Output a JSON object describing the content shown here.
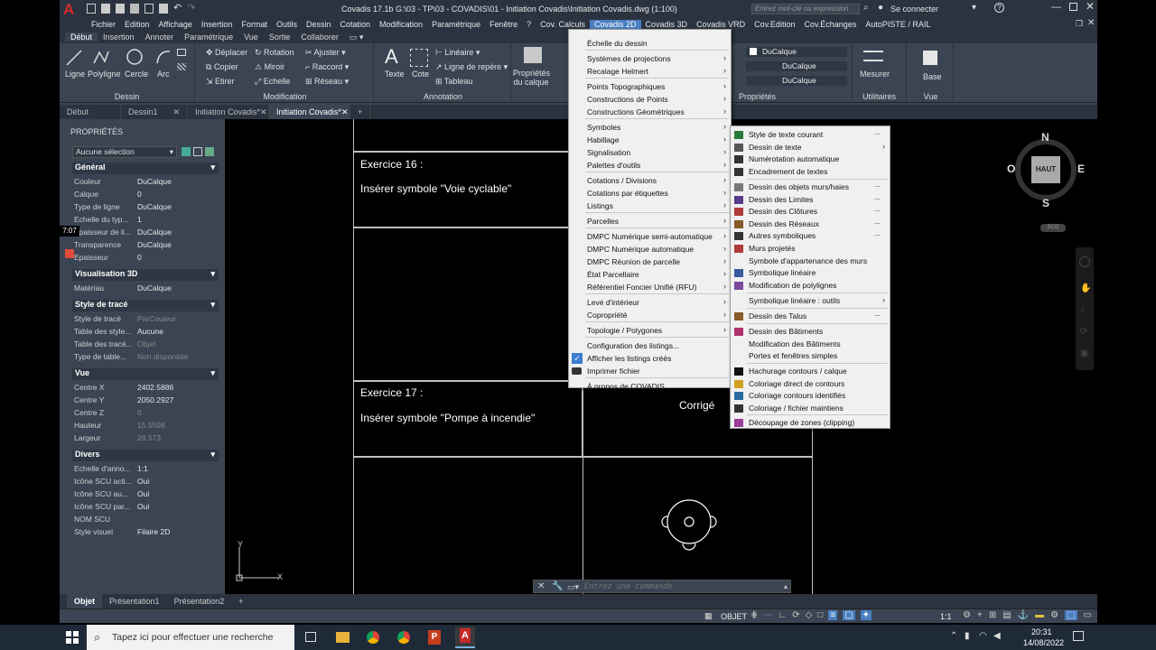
{
  "titlebar": {
    "title": "Covadis 17.1b   G:\\03 - TP\\03 - COVADIS\\01 - Initiation Covadis\\Initiation Covadis.dwg (1:100)",
    "search_placeholder": "Entrez mot-clé ou expression",
    "signin": "Se connecter"
  },
  "menubar": [
    "Fichier",
    "Edition",
    "Affichage",
    "Insertion",
    "Format",
    "Outils",
    "Dessin",
    "Cotation",
    "Modification",
    "Paramétrique",
    "Fenêtre",
    "?",
    "Cov. Calculs",
    "Covadis 2D",
    "Covadis 3D",
    "Covadis VRD",
    "Cov.Edition",
    "Cov.Échanges",
    "AutoPISTE / RAIL"
  ],
  "menubar_active": "Covadis 2D",
  "ribbon_tabs": [
    "Début",
    "Insertion",
    "Annoter",
    "Paramétrique",
    "Vue",
    "Sortie",
    "Collaborer"
  ],
  "ribbon": {
    "dessin": {
      "title": "Dessin",
      "ligne": "Ligne",
      "polyligne": "Polyligne",
      "cercle": "Cercle",
      "arc": "Arc"
    },
    "modification": {
      "title": "Modification",
      "deplacer": "Déplacer",
      "rotation": "Rotation",
      "ajuster": "Ajuster",
      "copier": "Copier",
      "miroir": "Miroir",
      "raccord": "Raccord",
      "etirer": "Etirer",
      "echelle": "Echelle",
      "reseau": "Réseau"
    },
    "annotation": {
      "title": "Annotation",
      "texte": "Texte",
      "cote": "Cote",
      "lineaire": "Linéaire",
      "ligne_repere": "Ligne de repère",
      "tableau": "Tableau"
    },
    "calques": {
      "proprietes": "Propriétés du calque"
    },
    "proprietes": {
      "title": "Propriétés",
      "c1": "DuCalque",
      "c2": "DuCalque",
      "c3": "DuCalque"
    },
    "utilitaires": {
      "title": "Utilitaires",
      "mesurer": "Mesurer"
    },
    "vue": {
      "title": "Vue",
      "base": "Base"
    }
  },
  "doc_tabs": [
    "Début",
    "Dessin1",
    "Initiation Covadis*",
    "Initiation Covadis*"
  ],
  "properties": {
    "title": "PROPRIÉTÉS",
    "selection": "Aucune sélection",
    "sections": {
      "general": "Général",
      "vis3d": "Visualisation 3D",
      "trace": "Style de tracé",
      "vue": "Vue",
      "divers": "Divers"
    },
    "general": [
      [
        "Couleur",
        "DuCalque"
      ],
      [
        "Calque",
        "0"
      ],
      [
        "Type de ligne",
        "DuCalque"
      ],
      [
        "Echelle du typ...",
        "1"
      ],
      [
        "Epaisseur de li...",
        "DuCalque"
      ],
      [
        "Transparence",
        "DuCalque"
      ],
      [
        "Epaisseur",
        "0"
      ]
    ],
    "vis3d": [
      [
        "Matériau",
        "DuCalque"
      ]
    ],
    "trace": [
      [
        "Style de tracé",
        "ParCouleur"
      ],
      [
        "Table des style...",
        "Aucune"
      ],
      [
        "Table des tracé...",
        "Objet"
      ],
      [
        "Type de table...",
        "Non disponible"
      ]
    ],
    "vue": [
      [
        "Centre X",
        "2402.5886"
      ],
      [
        "Centre Y",
        "2050.2927"
      ],
      [
        "Centre Z",
        "0"
      ],
      [
        "Hauteur",
        "15.5598"
      ],
      [
        "Largeur",
        "28.573"
      ]
    ],
    "divers": [
      [
        "Echelle d'anno...",
        "1:1"
      ],
      [
        "Icône SCU acti...",
        "Oui"
      ],
      [
        "Icône SCU au...",
        "Oui"
      ],
      [
        "Icône SCU par...",
        "Oui"
      ],
      [
        "NOM SCU",
        ""
      ],
      [
        "Style visuel",
        "Filaire 2D"
      ]
    ],
    "timer": "7:07"
  },
  "canvas": {
    "ex16_title": "Exercice 16 :",
    "ex16_text": "Insérer symbole \"Voie cyclable\"",
    "ex17_title": "Exercice 17 :",
    "ex17_text": "Insérer symbole \"Pompe à incendie\"",
    "corrige": "Corrigé",
    "command_placeholder": "Entrez une commande",
    "viewcube": {
      "n": "N",
      "s": "S",
      "e": "E",
      "o": "O",
      "top": "HAUT",
      "scu": "SCG"
    },
    "ucs_y": "Y",
    "ucs_x": "X"
  },
  "menu_covadis2d": [
    {
      "label": "Échelle du dessin",
      "arrow": false
    },
    {
      "label": "Systèmes de projections",
      "arrow": true
    },
    {
      "label": "Recalage Helmert",
      "arrow": true
    },
    {
      "label": "Points Topographiques",
      "arrow": true
    },
    {
      "label": "Constructions de Points",
      "arrow": true
    },
    {
      "label": "Constructions Géométriques",
      "arrow": true
    },
    {
      "label": "Symboles",
      "arrow": true
    },
    {
      "label": "Habillage",
      "arrow": true
    },
    {
      "label": "Signalisation",
      "arrow": true
    },
    {
      "label": "Palettes d'outils",
      "arrow": true
    },
    {
      "label": "Cotations / Divisions",
      "arrow": true
    },
    {
      "label": "Cotations par étiquettes",
      "arrow": true
    },
    {
      "label": "Listings",
      "arrow": true
    },
    {
      "label": "Parcelles",
      "arrow": true
    },
    {
      "label": "DMPC Numérique semi-automatique",
      "arrow": true
    },
    {
      "label": "DMPC Numérique automatique",
      "arrow": true
    },
    {
      "label": "DMPC Réunion de parcelle",
      "arrow": true
    },
    {
      "label": "État Parcellaire",
      "arrow": true
    },
    {
      "label": "Référentiel Foncier Unifié (RFU)",
      "arrow": true
    },
    {
      "label": "Levé d'intérieur",
      "arrow": true
    },
    {
      "label": "Copropriété",
      "arrow": true
    },
    {
      "label": "Topologie / Polygones",
      "arrow": true
    },
    {
      "label": "Configuration des listings...",
      "arrow": false
    },
    {
      "label": "Afficher les listings créés",
      "arrow": false
    },
    {
      "label": "Imprimer fichier",
      "arrow": false
    },
    {
      "label": "À propos de COVADIS...",
      "arrow": false
    }
  ],
  "menu_habillage": [
    {
      "label": "Style de texte courant",
      "more": "..."
    },
    {
      "label": "Dessin de texte",
      "more": ">"
    },
    {
      "label": "Numérotation automatique",
      "more": ""
    },
    {
      "label": "Encadrement de textes",
      "more": ""
    },
    {
      "label": "Dessin des objets murs/haies",
      "more": "..."
    },
    {
      "label": "Dessin des Limites",
      "more": "..."
    },
    {
      "label": "Dessin des Clôtures",
      "more": "..."
    },
    {
      "label": "Dessin des Réseaux",
      "more": "..."
    },
    {
      "label": "Autres symboliques",
      "more": "..."
    },
    {
      "label": "Murs projetés",
      "more": ""
    },
    {
      "label": "Symbole d'appartenance des murs",
      "more": ""
    },
    {
      "label": "Symbolique linéaire",
      "more": ""
    },
    {
      "label": "Modification de polylignes",
      "more": ""
    },
    {
      "label": "Symbolique linéaire : outils",
      "more": ">"
    },
    {
      "label": "Dessin des Talus",
      "more": "..."
    },
    {
      "label": "Dessin des Bâtiments",
      "more": ""
    },
    {
      "label": "Modification des Bâtiments",
      "more": ""
    },
    {
      "label": "Portes et fenêtres simples",
      "more": ""
    },
    {
      "label": "Hachurage contours / calque",
      "more": ""
    },
    {
      "label": "Coloriage direct de contours",
      "more": ""
    },
    {
      "label": "Coloriage contours identifiés",
      "more": ""
    },
    {
      "label": "Coloriage / fichier maintiens",
      "more": ""
    },
    {
      "label": "Découpage de zones (clipping)",
      "more": ""
    }
  ],
  "layout_tabs": [
    "Objet",
    "Présentation1",
    "Présentation2"
  ],
  "statusbar": {
    "objet": "OBJET",
    "scale": "1:1"
  },
  "taskbar": {
    "search_placeholder": "Tapez ici pour effectuer une recherche",
    "time": "20:31",
    "date": "14/08/2022"
  }
}
